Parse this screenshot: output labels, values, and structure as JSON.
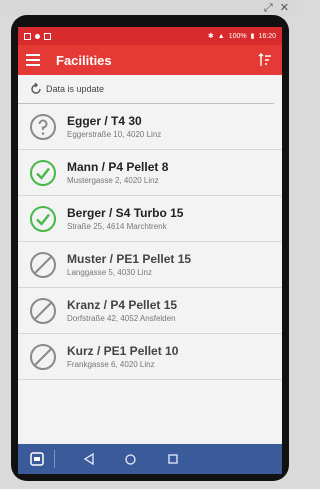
{
  "colors": {
    "primary": "#e53935",
    "status_bar": "#d72b2e",
    "success": "#46b84a",
    "muted": "#8a8a8a",
    "nav_bar": "#3a5a9a"
  },
  "host_icons": {
    "left": "⤢",
    "right": "✕"
  },
  "status_bar": {
    "battery": "100%",
    "time": "16:20"
  },
  "app_bar": {
    "title": "Facilities",
    "menu_icon": "menu-icon",
    "sort_icon": "sort-icon"
  },
  "sync_status": {
    "text": "Data is update",
    "icon": "refresh-icon"
  },
  "facilities": [
    {
      "title": "Egger / T4 30",
      "address": "Eggerstraße 10, 4020 Linz",
      "status": "unknown",
      "icon": "question-icon"
    },
    {
      "title": "Mann / P4 Pellet 8",
      "address": "Mustergasse 2, 4020 Linz",
      "status": "ok",
      "icon": "check-icon"
    },
    {
      "title": "Berger / S4 Turbo 15",
      "address": "Straße 25, 4614 Marchtrenk",
      "status": "ok",
      "icon": "check-icon"
    },
    {
      "title": "Muster / PE1 Pellet 15",
      "address": "Langgasse 5, 4030 Linz",
      "status": "disabled",
      "icon": "disabled-icon"
    },
    {
      "title": "Kranz / P4 Pellet 15",
      "address": "Dorfstraße 42, 4052 Ansfelden",
      "status": "disabled",
      "icon": "disabled-icon"
    },
    {
      "title": "Kurz / PE1 Pellet 10",
      "address": "Frankgasse 6, 4020 Linz",
      "status": "disabled",
      "icon": "disabled-icon"
    }
  ]
}
